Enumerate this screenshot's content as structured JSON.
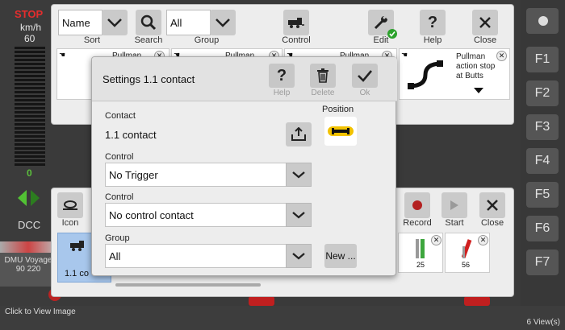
{
  "cab": {
    "stop": "STOP",
    "unit": "km/h",
    "speed": "60",
    "meter": "0",
    "mode": "DCC"
  },
  "functions": [
    "F1",
    "F2",
    "F3",
    "F4",
    "F5",
    "F6",
    "F7"
  ],
  "train": {
    "name": "DMU Voyage",
    "number": "90 220"
  },
  "toolbar": {
    "sort_value": "Name",
    "sort_label": "Sort",
    "search_label": "Search",
    "group_value": "All",
    "group_label": "Group",
    "control_label": "Control",
    "edit_label": "Edit",
    "help_label": "Help",
    "close_label": "Close"
  },
  "cards": [
    {
      "label": "Pullman"
    },
    {
      "label": "Pullman"
    },
    {
      "label": "Pullman"
    },
    {
      "label": "Pullman action stop at Butts"
    }
  ],
  "bottom": {
    "icon_label": "Icon",
    "record_label": "Record",
    "start_label": "Start",
    "close_label": "Close",
    "item_label": "1.1 co",
    "signal_a": "25",
    "signal_b": "56"
  },
  "modal": {
    "title": "Settings 1.1 contact",
    "help_label": "Help",
    "delete_label": "Delete",
    "ok_label": "Ok",
    "contact_label": "Contact",
    "contact_value": "1.1 contact",
    "position_label": "Position",
    "control1_label": "Control",
    "control1_value": "No Trigger",
    "control2_label": "Control",
    "control2_value": "No control contact",
    "group_label": "Group",
    "group_value": "All",
    "new_label": "New ..."
  },
  "status": {
    "left": "Click to View Image",
    "right": "6 View(s)"
  },
  "colors": {
    "accent_green": "#52c234",
    "stop_red": "#e52d2d",
    "position_yellow": "#f2c200",
    "record_red": "#b32020"
  }
}
